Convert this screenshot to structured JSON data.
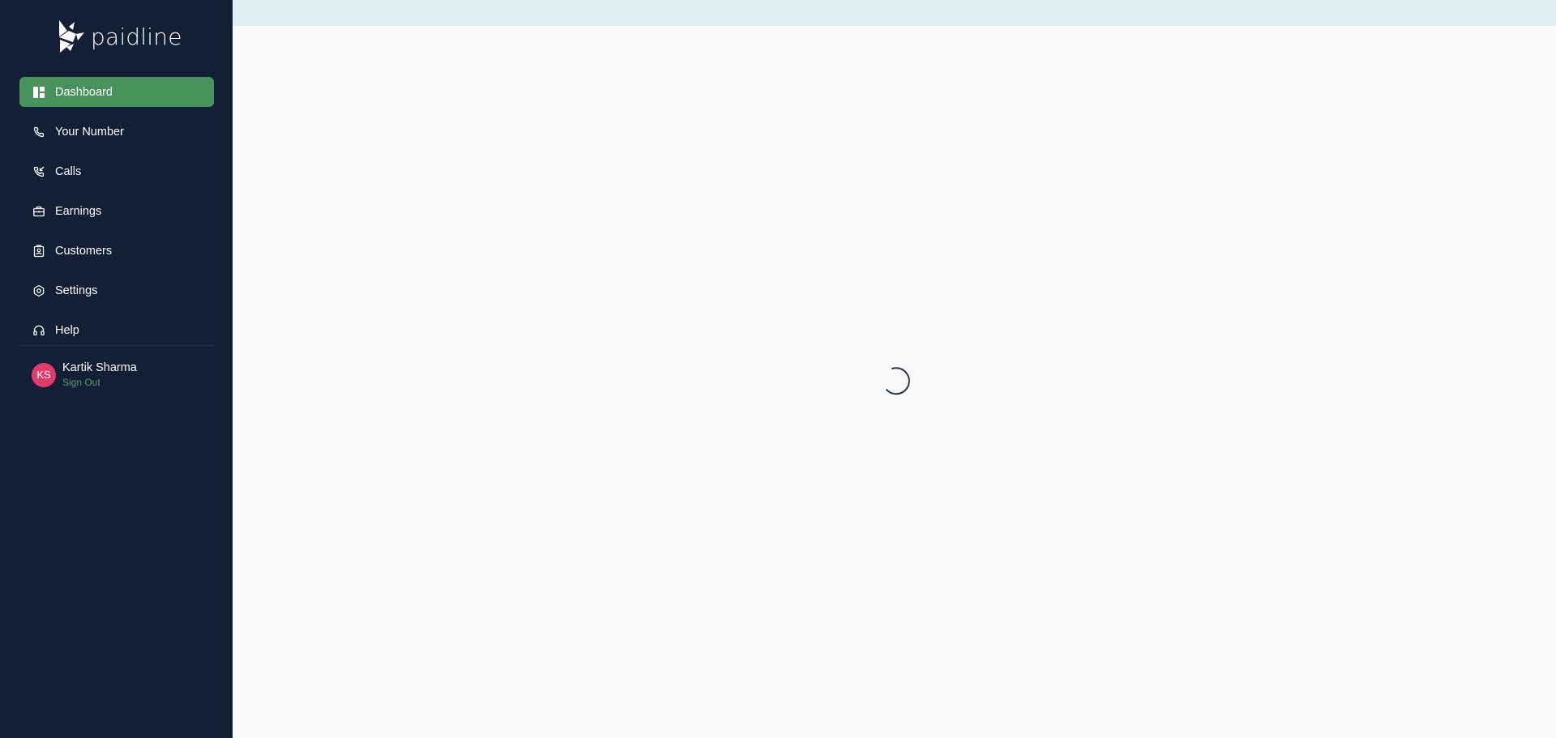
{
  "brand": {
    "name": "paidline",
    "accent": "#47935b",
    "sidebar_bg": "#131f36"
  },
  "sidebar": {
    "items": [
      {
        "label": "Dashboard",
        "icon": "dashboard-icon",
        "active": true
      },
      {
        "label": "Your Number",
        "icon": "phone-icon",
        "active": false
      },
      {
        "label": "Calls",
        "icon": "phone-incoming-icon",
        "active": false
      },
      {
        "label": "Earnings",
        "icon": "briefcase-icon",
        "active": false
      },
      {
        "label": "Customers",
        "icon": "contact-card-icon",
        "active": false
      },
      {
        "label": "Settings",
        "icon": "gear-icon",
        "active": false
      },
      {
        "label": "Help",
        "icon": "headset-icon",
        "active": false
      }
    ]
  },
  "user": {
    "initials": "KS",
    "name": "Kartik Sharma",
    "sign_out_label": "Sign Out",
    "avatar_color": "#e13b6b"
  },
  "main": {
    "state": "loading",
    "topbar_color": "#dff0f0"
  }
}
